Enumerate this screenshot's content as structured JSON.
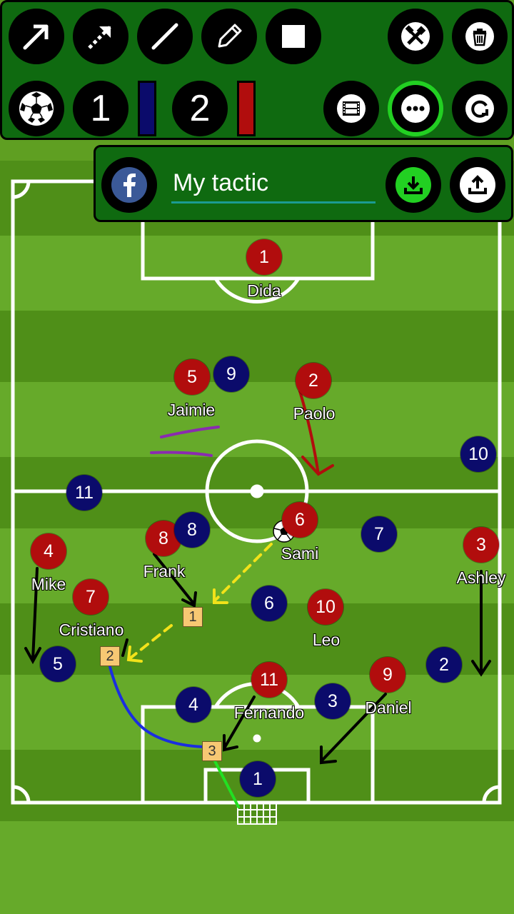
{
  "toolbar": {
    "tools": [
      "arrow-tool",
      "dashed-arrow-tool",
      "line-tool",
      "pencil-tool",
      "shape-tool"
    ],
    "team1_label": "1",
    "team2_label": "2",
    "team1_color": "#0b0b6b",
    "team2_color": "#b10d0d",
    "active_tool": "more-options"
  },
  "savebar": {
    "tactic_name": "My tactic",
    "save_accent": "#22d022"
  },
  "colors": {
    "red_team": "#b10d0d",
    "blue_team": "#0b0b6b",
    "panel_bg": "#0f6a10"
  },
  "players": {
    "red": [
      {
        "number": "1",
        "name": "Dida"
      },
      {
        "number": "5",
        "name": "Jaimie"
      },
      {
        "number": "2",
        "name": "Paolo"
      },
      {
        "number": "6",
        "name": "Sami"
      },
      {
        "number": "8",
        "name": "Frank"
      },
      {
        "number": "4",
        "name": "Mike"
      },
      {
        "number": "7",
        "name": "Cristiano"
      },
      {
        "number": "3",
        "name": "Ashley"
      },
      {
        "number": "10",
        "name": "Leo"
      },
      {
        "number": "11",
        "name": "Fernando"
      },
      {
        "number": "9",
        "name": "Daniel"
      }
    ],
    "blue": [
      "9",
      "10",
      "11",
      "8",
      "7",
      "6",
      "5",
      "2",
      "4",
      "3",
      "1"
    ]
  },
  "markers": [
    "1",
    "2",
    "3"
  ]
}
